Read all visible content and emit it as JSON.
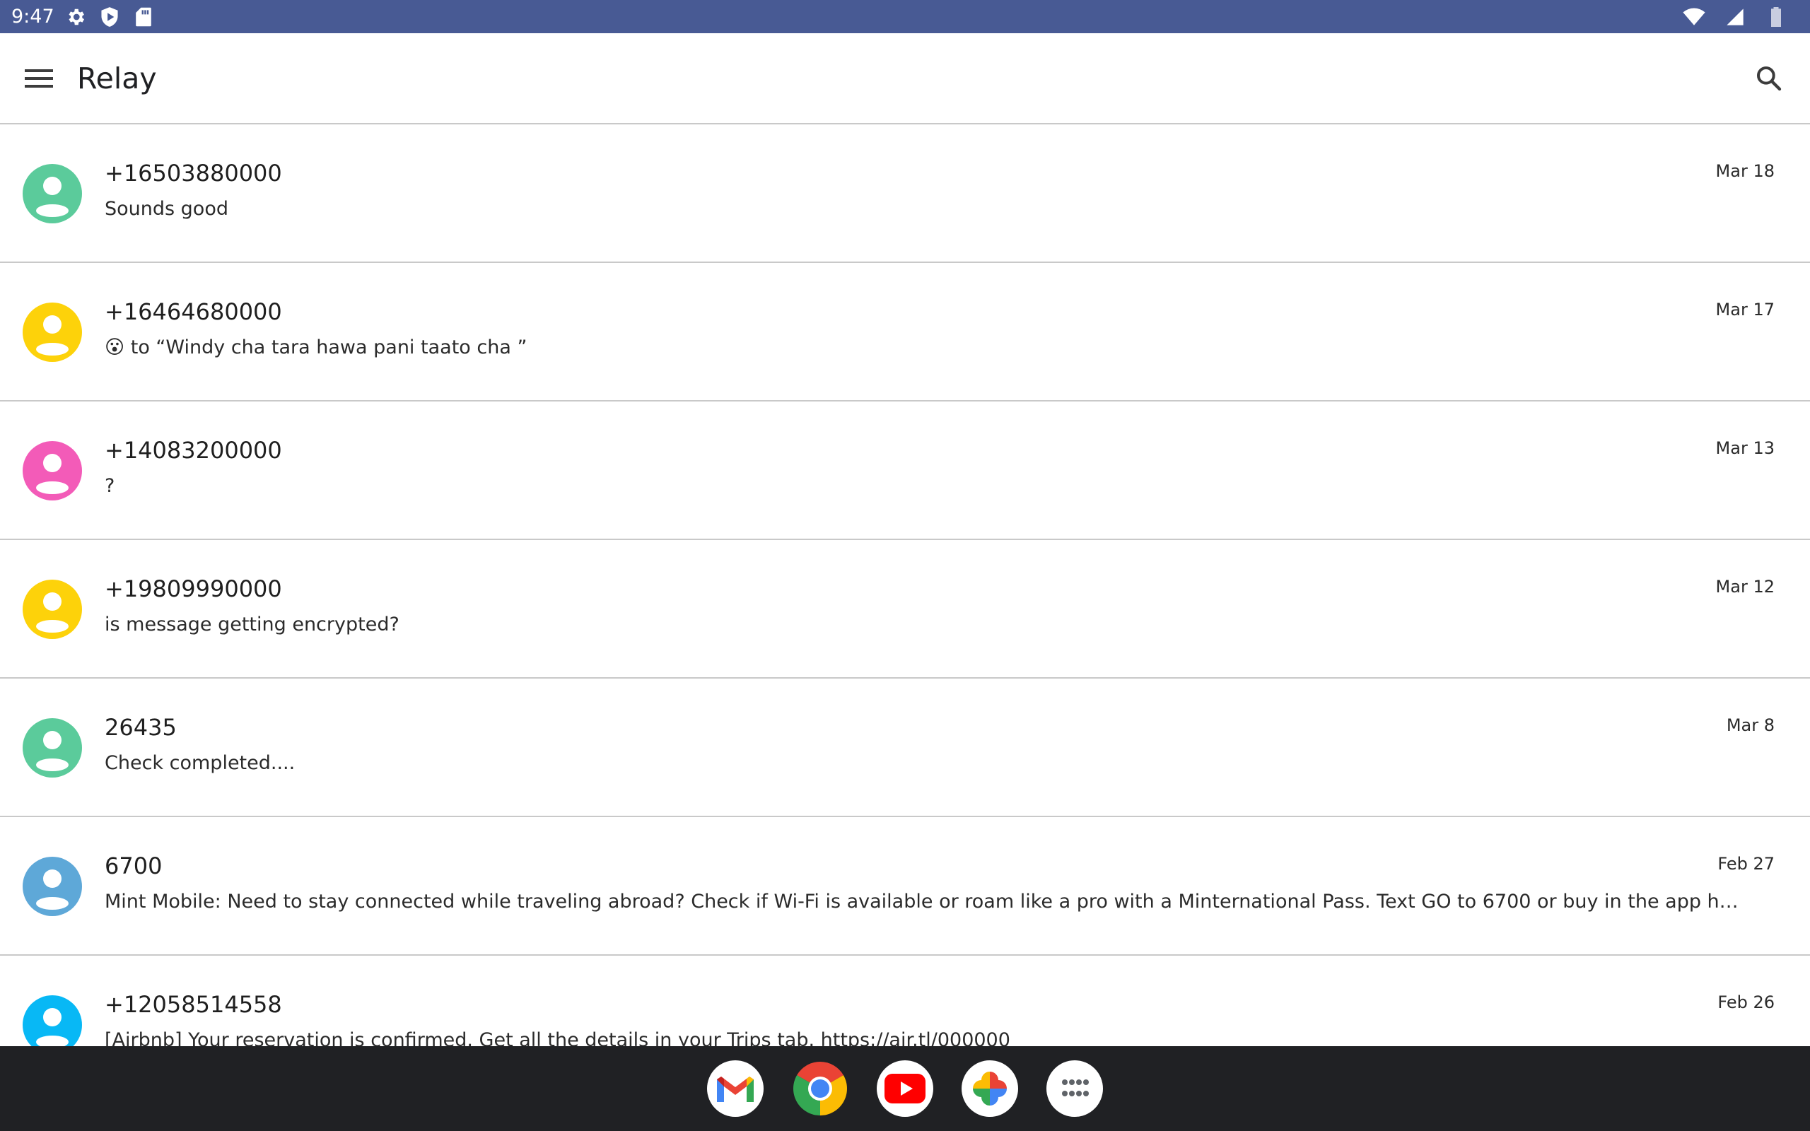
{
  "status_bar": {
    "time": "9:47",
    "icons": [
      "gear-icon",
      "play-shield-icon",
      "sd-card-icon",
      "wifi-icon",
      "signal-icon",
      "battery-icon"
    ]
  },
  "app_bar": {
    "title": "Relay",
    "menu_icon": "hamburger-menu-icon",
    "search_icon": "search-icon"
  },
  "conversations": [
    {
      "name": "+16503880000",
      "snippet": "Sounds good",
      "date": "Mar 18",
      "avatar_color": "#5bcb9b"
    },
    {
      "name": "+16464680000",
      "snippet": "😮 to “Windy cha tara hawa pani taato cha ”",
      "date": "Mar 17",
      "avatar_color": "#fdd20a"
    },
    {
      "name": "+14083200000",
      "snippet": "?",
      "date": "Mar 13",
      "avatar_color": "#f35bb8"
    },
    {
      "name": "+19809990000",
      "snippet": "is message getting encrypted?",
      "date": "Mar 12",
      "avatar_color": "#fdd20a"
    },
    {
      "name": "26435",
      "snippet": "Check completed....",
      "date": "Mar 8",
      "avatar_color": "#5bcb9b"
    },
    {
      "name": "6700",
      "snippet": "Mint Mobile: Need to stay connected while traveling abroad? Check if Wi-Fi is available or roam like a pro with a Minternational Pass. Text GO to 6700 or buy in the app https://m.mi...",
      "date": "Feb 27",
      "avatar_color": "#5ea8d8"
    },
    {
      "name": "+12058514558",
      "snippet": "[Airbnb] Your reservation is confirmed. Get all the details in your Trips tab. https://air.tl/000000",
      "date": "Feb 26",
      "avatar_color": "#08b8f5"
    }
  ],
  "dock": {
    "apps": [
      "gmail-icon",
      "chrome-icon",
      "youtube-icon",
      "photos-icon",
      "app-drawer-icon"
    ]
  }
}
